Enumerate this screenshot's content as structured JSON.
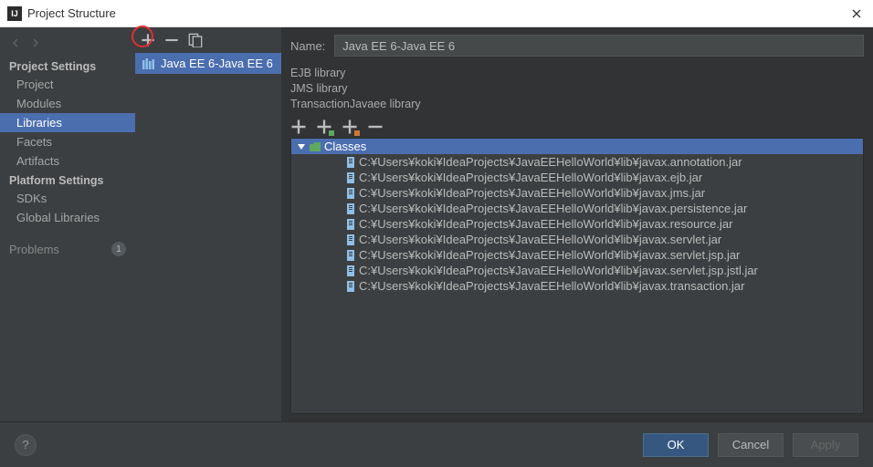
{
  "title": "Project Structure",
  "sidebar": {
    "sections": [
      {
        "label": "Project Settings",
        "items": [
          "Project",
          "Modules",
          "Libraries",
          "Facets",
          "Artifacts"
        ],
        "selected": 2
      },
      {
        "label": "Platform Settings",
        "items": [
          "SDKs",
          "Global Libraries"
        ]
      }
    ],
    "problems": {
      "label": "Problems",
      "count": "1"
    }
  },
  "library_list": {
    "selected": {
      "name": "Java EE 6-Java EE 6"
    }
  },
  "main": {
    "name_label": "Name:",
    "name_value": "Java EE 6-Java EE 6",
    "summary": [
      "EJB library",
      "JMS library",
      "TransactionJavaee library"
    ],
    "classes_label": "Classes",
    "jars": [
      "C:¥Users¥koki¥IdeaProjects¥JavaEEHelloWorld¥lib¥javax.annotation.jar",
      "C:¥Users¥koki¥IdeaProjects¥JavaEEHelloWorld¥lib¥javax.ejb.jar",
      "C:¥Users¥koki¥IdeaProjects¥JavaEEHelloWorld¥lib¥javax.jms.jar",
      "C:¥Users¥koki¥IdeaProjects¥JavaEEHelloWorld¥lib¥javax.persistence.jar",
      "C:¥Users¥koki¥IdeaProjects¥JavaEEHelloWorld¥lib¥javax.resource.jar",
      "C:¥Users¥koki¥IdeaProjects¥JavaEEHelloWorld¥lib¥javax.servlet.jar",
      "C:¥Users¥koki¥IdeaProjects¥JavaEEHelloWorld¥lib¥javax.servlet.jsp.jar",
      "C:¥Users¥koki¥IdeaProjects¥JavaEEHelloWorld¥lib¥javax.servlet.jsp.jstl.jar",
      "C:¥Users¥koki¥IdeaProjects¥JavaEEHelloWorld¥lib¥javax.transaction.jar"
    ]
  },
  "footer": {
    "ok": "OK",
    "cancel": "Cancel",
    "apply": "Apply"
  }
}
